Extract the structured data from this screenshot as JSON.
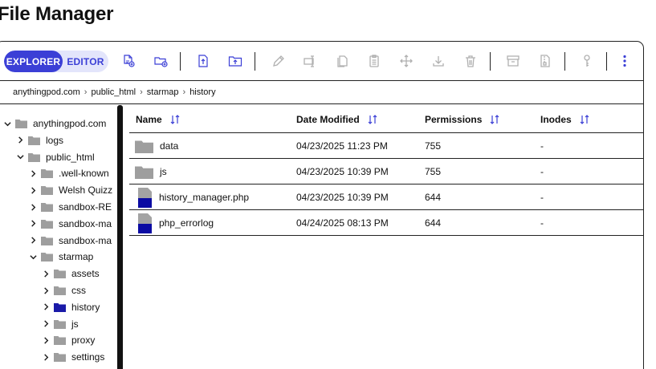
{
  "page": {
    "title": "File Manager"
  },
  "toolbar": {
    "explorer_label": "EXPLORER",
    "editor_label": "EDITOR",
    "tools": [
      {
        "name": "new-file-icon"
      },
      {
        "name": "new-folder-icon"
      },
      {
        "name": "upload-file-icon"
      },
      {
        "name": "upload-folder-icon"
      },
      {
        "name": "edit-icon"
      },
      {
        "name": "rename-icon"
      },
      {
        "name": "copy-icon"
      },
      {
        "name": "paste-icon"
      },
      {
        "name": "move-icon"
      },
      {
        "name": "download-icon"
      },
      {
        "name": "delete-icon"
      },
      {
        "name": "archive-icon"
      },
      {
        "name": "extract-icon"
      },
      {
        "name": "permissions-key-icon"
      },
      {
        "name": "more-options-icon"
      }
    ]
  },
  "breadcrumb": [
    "anythingpod.com",
    "public_html",
    "starmap",
    "history"
  ],
  "tree": [
    {
      "label": "anythingpod.com",
      "state": "open",
      "selected": false
    },
    {
      "label": "logs",
      "state": "closed",
      "selected": false
    },
    {
      "label": "public_html",
      "state": "open",
      "selected": false
    },
    {
      "label": ".well-known",
      "state": "closed",
      "selected": false
    },
    {
      "label": "Welsh Quizz",
      "state": "closed",
      "selected": false
    },
    {
      "label": "sandbox-RE",
      "state": "closed",
      "selected": false
    },
    {
      "label": "sandbox-ma",
      "state": "closed",
      "selected": false
    },
    {
      "label": "sandbox-ma",
      "state": "closed",
      "selected": false
    },
    {
      "label": "starmap",
      "state": "open",
      "selected": false
    },
    {
      "label": "assets",
      "state": "closed",
      "selected": false
    },
    {
      "label": "css",
      "state": "closed",
      "selected": false
    },
    {
      "label": "history",
      "state": "closed",
      "selected": true
    },
    {
      "label": "js",
      "state": "closed",
      "selected": false
    },
    {
      "label": "proxy",
      "state": "closed",
      "selected": false
    },
    {
      "label": "settings",
      "state": "closed",
      "selected": false
    }
  ],
  "table": {
    "columns": [
      "Name",
      "Date Modified",
      "Permissions",
      "Inodes"
    ],
    "rows": [
      {
        "type": "folder",
        "name": "data",
        "modified": "04/23/2025 11:23 PM",
        "permissions": "755",
        "inodes": "-"
      },
      {
        "type": "folder",
        "name": "js",
        "modified": "04/23/2025 10:39 PM",
        "permissions": "755",
        "inodes": "-"
      },
      {
        "type": "file",
        "name": "history_manager.php",
        "modified": "04/23/2025 10:39 PM",
        "permissions": "644",
        "inodes": "-"
      },
      {
        "type": "file",
        "name": "php_errorlog",
        "modified": "04/24/2025 08:13 PM",
        "permissions": "644",
        "inodes": "-"
      }
    ]
  },
  "colors": {
    "accent": "#3b3fd6",
    "accent_light": "#e3e5fb",
    "folder_gray": "#9e9e9e",
    "selected_folder": "#1a1aa8",
    "file_blue": "#0b0ba3"
  }
}
